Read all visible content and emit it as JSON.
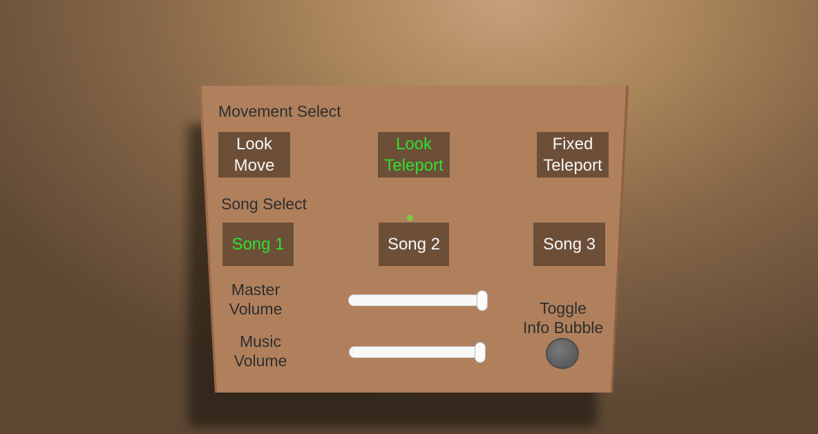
{
  "movement": {
    "heading": "Movement Select",
    "options": [
      {
        "line1": "Look",
        "line2": "Move"
      },
      {
        "line1": "Look",
        "line2": "Teleport"
      },
      {
        "line1": "Fixed",
        "line2": "Teleport"
      }
    ],
    "selected": "Look Teleport"
  },
  "song": {
    "heading": "Song Select",
    "options": [
      "Song 1",
      "Song 2",
      "Song 3"
    ],
    "selected": "Song 1"
  },
  "master_volume": {
    "line1": "Master",
    "line2": "Volume",
    "value": 1.0
  },
  "music_volume": {
    "line1": "Music",
    "line2": "Volume",
    "value": 1.0
  },
  "toggle_info": {
    "line1": "Toggle",
    "line2": "Info Bubble"
  },
  "colors": {
    "selected_text": "#2de02d",
    "button_bg": "#6d4f38",
    "panel": "#b0805c",
    "pointer_dot": "#7ccc45"
  }
}
